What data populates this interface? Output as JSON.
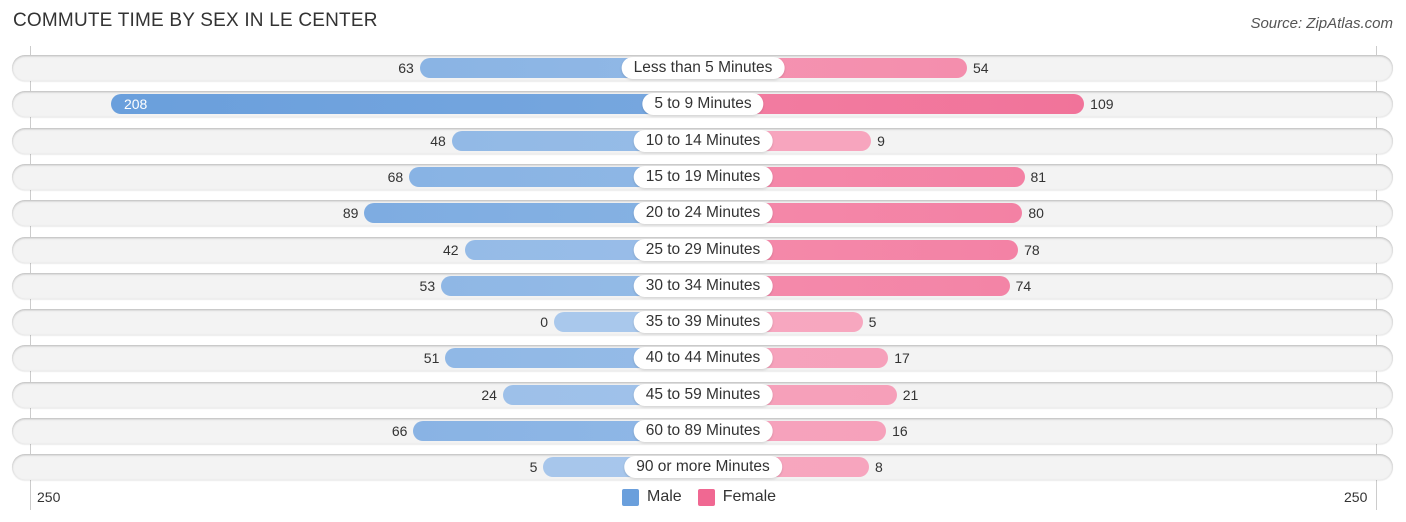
{
  "header": {
    "title": "COMMUTE TIME BY SEX IN LE CENTER",
    "source": "Source: ZipAtlas.com"
  },
  "colors": {
    "male_strong": "#6a9fdc",
    "male_light": "#a9c8ec",
    "female_strong": "#f06892",
    "female_light": "#f7a9c1"
  },
  "chart_data": {
    "type": "bar",
    "orientation": "horizontal-diverging",
    "title": "COMMUTE TIME BY SEX IN LE CENTER",
    "categories": [
      "Less than 5 Minutes",
      "5 to 9 Minutes",
      "10 to 14 Minutes",
      "15 to 19 Minutes",
      "20 to 24 Minutes",
      "25 to 29 Minutes",
      "30 to 34 Minutes",
      "35 to 39 Minutes",
      "40 to 44 Minutes",
      "45 to 59 Minutes",
      "60 to 89 Minutes",
      "90 or more Minutes"
    ],
    "series": [
      {
        "name": "Male",
        "values": [
          63,
          208,
          48,
          68,
          89,
          42,
          53,
          0,
          51,
          24,
          66,
          5
        ]
      },
      {
        "name": "Female",
        "values": [
          54,
          109,
          9,
          81,
          80,
          78,
          74,
          5,
          17,
          21,
          16,
          8
        ]
      }
    ],
    "xlim": [
      -250,
      250
    ],
    "tick_labels": {
      "left": "250",
      "right": "250"
    },
    "legend": {
      "position": "bottom-center",
      "entries": [
        "Male",
        "Female"
      ]
    },
    "grid": false
  }
}
